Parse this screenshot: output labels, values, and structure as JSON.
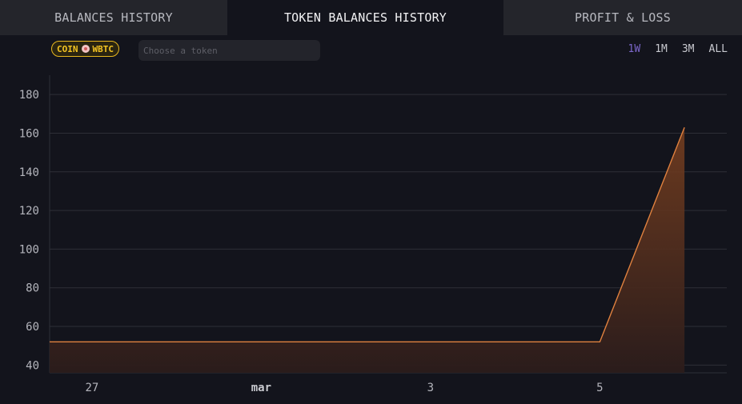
{
  "tabs": [
    {
      "label": "BALANCES HISTORY",
      "active": false
    },
    {
      "label": "TOKEN BALANCES HISTORY",
      "active": true
    },
    {
      "label": "PROFIT & LOSS",
      "active": false
    }
  ],
  "chip": {
    "coin": "COIN",
    "token": "WBTC",
    "color": "#f3c322"
  },
  "token_search": {
    "placeholder": "Choose a token"
  },
  "ranges": [
    {
      "label": "1W",
      "active": true
    },
    {
      "label": "1M",
      "active": false
    },
    {
      "label": "3M",
      "active": false
    },
    {
      "label": "ALL",
      "active": false
    }
  ],
  "chart_data": {
    "type": "area",
    "x_ticks": [
      {
        "label": "27",
        "x": 0.5,
        "bold": false
      },
      {
        "label": "mar",
        "x": 2.5,
        "bold": true
      },
      {
        "label": "3",
        "x": 4.5,
        "bold": false
      },
      {
        "label": "5",
        "x": 6.5,
        "bold": false
      }
    ],
    "y_ticks": [
      40,
      60,
      80,
      100,
      120,
      140,
      160,
      180
    ],
    "ylim": [
      36,
      190
    ],
    "xlim": [
      0,
      8
    ],
    "series": [
      {
        "points": [
          {
            "x": 0,
            "y": 52
          },
          {
            "x": 6.5,
            "y": 52
          },
          {
            "x": 7.5,
            "y": 163
          }
        ]
      }
    ],
    "line_color": "#e0813f",
    "grid": true
  }
}
